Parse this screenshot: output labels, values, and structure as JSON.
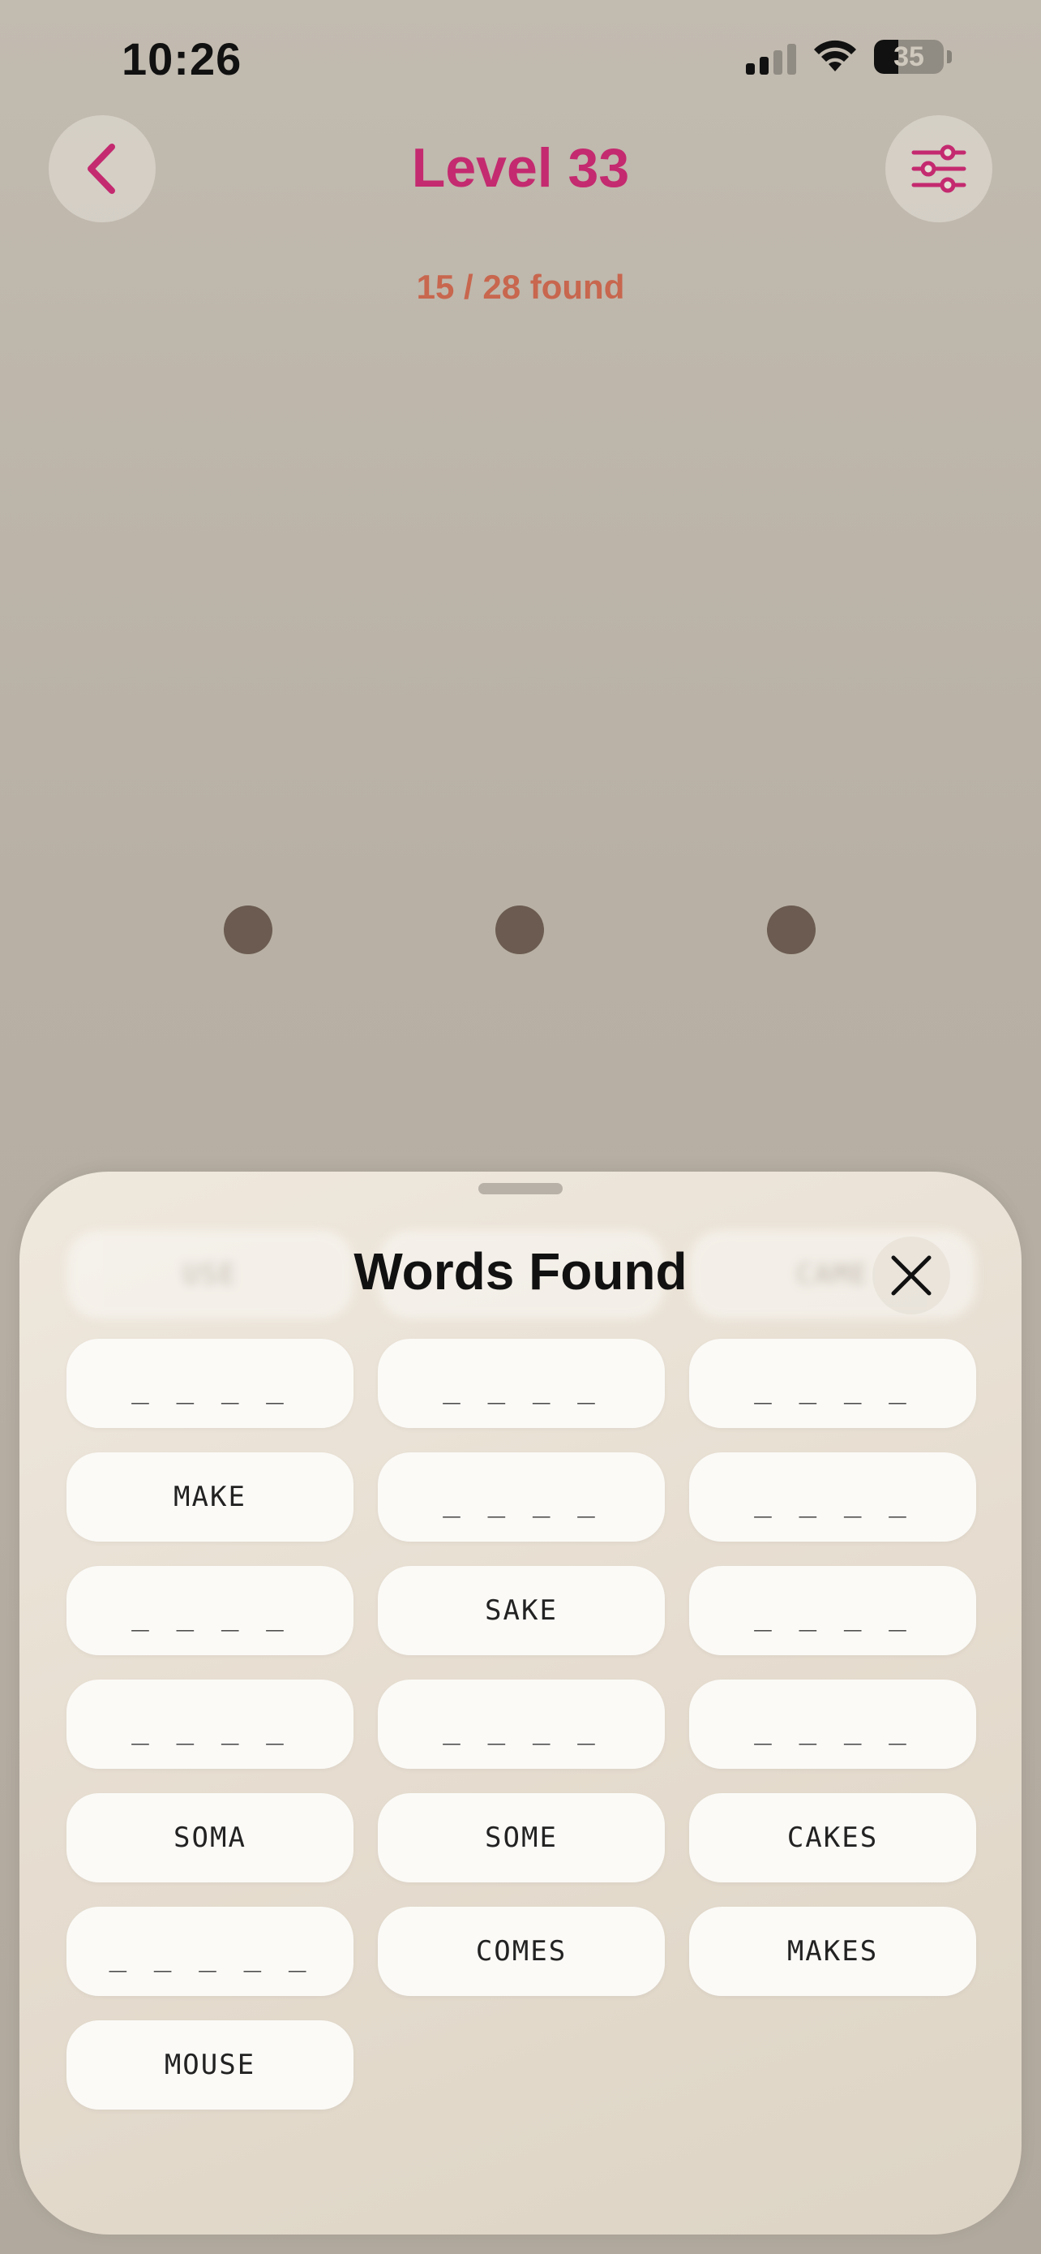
{
  "status_bar": {
    "time": "10:26",
    "battery_percent": "35",
    "signal_bars_active": 2,
    "signal_bars_total": 4
  },
  "header": {
    "title": "Level 33",
    "progress_text": "15 / 28 found",
    "back_icon": "chevron-left-icon",
    "settings_icon": "sliders-icon"
  },
  "colors": {
    "accent": "#c42a6f",
    "progress": "#c8664e",
    "dot": "#6b5b50",
    "tile": "#fbfaf7"
  },
  "letter_dots_count": 3,
  "words_sheet": {
    "title": "Words Found",
    "close_icon": "close-icon",
    "ghost_words": [
      "USE",
      "",
      "CAME"
    ],
    "words": [
      "_ _ _ _",
      "_ _ _ _",
      "_ _ _ _",
      "MAKE",
      "_ _ _ _",
      "_ _ _ _",
      "_ _ _ _",
      "SAKE",
      "_ _ _ _",
      "_ _ _ _",
      "_ _ _ _",
      "_ _ _ _",
      "SOMA",
      "SOME",
      "CAKES",
      "_ _ _ _ _",
      "COMES",
      "MAKES",
      "MOUSE"
    ]
  }
}
